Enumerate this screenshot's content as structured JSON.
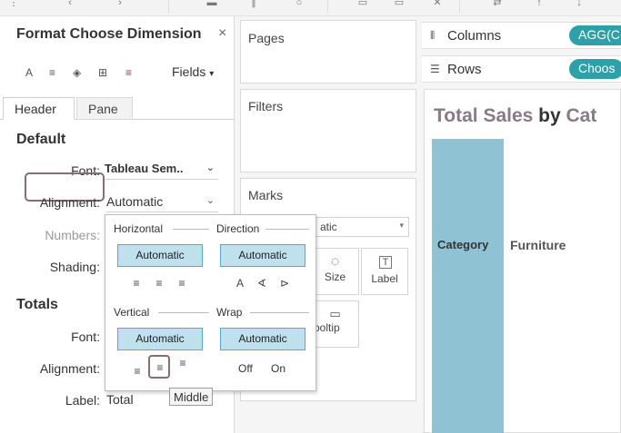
{
  "format_pane": {
    "title": "Format Choose Dimension",
    "close": "×",
    "fields_label": "Fields",
    "tabs": {
      "header": "Header",
      "pane": "Pane"
    },
    "default": {
      "section": "Default",
      "font_label": "Font:",
      "font_value": "Tableau Sem..",
      "alignment_label": "Alignment:",
      "alignment_value": "Automatic",
      "numbers_label": "Numbers:",
      "shading_label": "Shading:"
    },
    "totals": {
      "section": "Totals",
      "font_label": "Font:",
      "alignment_label": "Alignment:",
      "label_label": "Label:",
      "label_value": "Total"
    }
  },
  "alignment_popup": {
    "horizontal": "Horizontal",
    "direction": "Direction",
    "vertical": "Vertical",
    "wrap": "Wrap",
    "horizontal_value": "Automatic",
    "direction_value": "Automatic",
    "vertical_value": "Automatic",
    "wrap_value": "Automatic",
    "wrap_off": "Off",
    "wrap_on": "On",
    "tooltip": "Middle"
  },
  "shelves": {
    "pages": "Pages",
    "filters": "Filters",
    "marks": "Marks",
    "marks_type": "atic",
    "size": "Size",
    "label": "Label",
    "tooltip": "ooltip"
  },
  "view": {
    "columns_label": "Columns",
    "columns_pill": "AGG(C",
    "rows_label": "Rows",
    "rows_pill": "Choos",
    "title_part1": "Total Sales",
    "title_part2": " by ",
    "title_part3": "Cat",
    "category_header": "Category",
    "category_value": "Furniture"
  },
  "colors": {
    "accent_teal": "#2ea0a8",
    "selected_blue": "#bfe1ee",
    "category_column": "#8fc3d4",
    "title_mauve": "#8a7a85",
    "highlight_border": "#8a6e6e"
  }
}
